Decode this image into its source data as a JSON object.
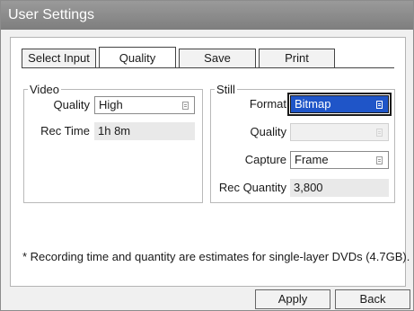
{
  "window": {
    "title": "User Settings"
  },
  "tabs": [
    {
      "label": "Select Input",
      "active": false
    },
    {
      "label": "Quality",
      "active": true
    },
    {
      "label": "Save",
      "active": false
    },
    {
      "label": "Print",
      "active": false
    }
  ],
  "video": {
    "legend": "Video",
    "quality_label": "Quality",
    "quality_value": "High",
    "rec_time_label": "Rec Time",
    "rec_time_value": "1h 8m"
  },
  "still": {
    "legend": "Still",
    "format_label": "Format",
    "format_value": "Bitmap",
    "quality_label": "Quality",
    "quality_value": "",
    "capture_label": "Capture",
    "capture_value": "Frame",
    "rec_quantity_label": "Rec Quantity",
    "rec_quantity_value": "3,800"
  },
  "note": "* Recording time and quantity are estimates for single-layer DVDs (4.7GB).",
  "footer": {
    "apply_label": "Apply",
    "back_label": "Back"
  },
  "colors": {
    "titlebar": "#8a8a8a",
    "focus_blue": "#1f55c8"
  },
  "icons": {
    "dropdown": "dropdown-arrow-icon"
  }
}
